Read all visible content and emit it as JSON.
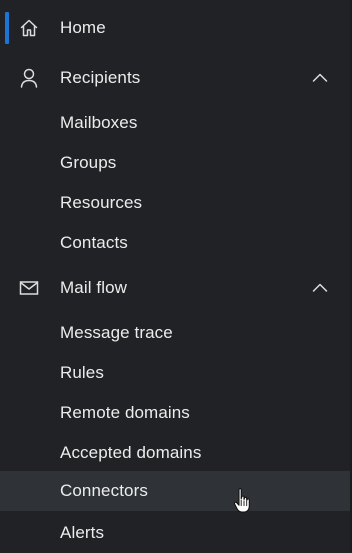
{
  "nav": {
    "home": {
      "label": "Home",
      "icon": "home-icon"
    },
    "recipients": {
      "label": "Recipients",
      "icon": "person-icon",
      "expanded": true,
      "items": [
        {
          "label": "Mailboxes"
        },
        {
          "label": "Groups"
        },
        {
          "label": "Resources"
        },
        {
          "label": "Contacts"
        }
      ]
    },
    "mailflow": {
      "label": "Mail flow",
      "icon": "mail-icon",
      "expanded": true,
      "items": [
        {
          "label": "Message trace"
        },
        {
          "label": "Rules"
        },
        {
          "label": "Remote domains"
        },
        {
          "label": "Accepted domains"
        },
        {
          "label": "Connectors",
          "hovered": true
        },
        {
          "label": "Alerts"
        }
      ]
    }
  },
  "colors": {
    "background": "#202225",
    "hover": "#2f3337",
    "accent": "#1e73d6",
    "text": "#ececec"
  }
}
